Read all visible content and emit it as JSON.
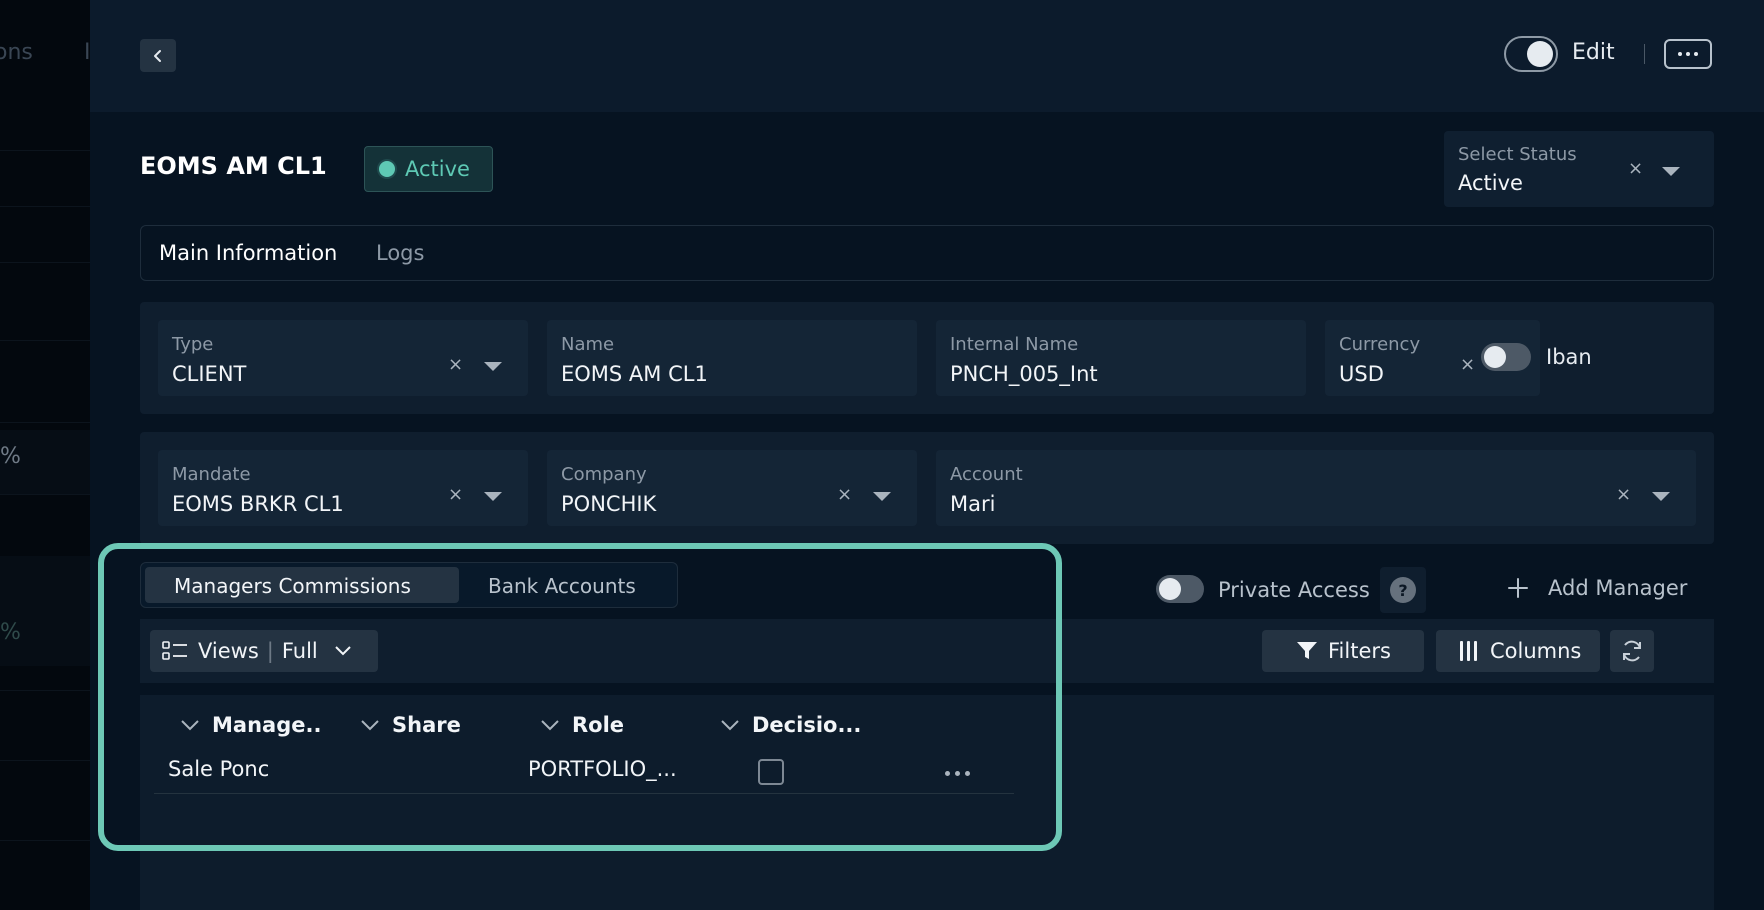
{
  "background": {
    "fragments": [
      "ons",
      "I",
      "%",
      "%"
    ]
  },
  "header": {
    "back_icon": "chevron-left-icon",
    "edit_label": "Edit",
    "edit_toggle_on": true
  },
  "record": {
    "title": "EOMS AM CL1",
    "status_badge": "Active",
    "status_color": "#5ec9b4"
  },
  "select_status": {
    "label": "Select Status",
    "value": "Active"
  },
  "tabs": [
    {
      "label": "Main Information",
      "active": true
    },
    {
      "label": "Logs",
      "active": false
    }
  ],
  "fields_row1": {
    "type": {
      "label": "Type",
      "value": "CLIENT"
    },
    "name": {
      "label": "Name",
      "value": "EOMS AM CL1"
    },
    "internal_name": {
      "label": "Internal Name",
      "value": "PNCH_005_Int"
    },
    "currency": {
      "label": "Currency",
      "value": "USD"
    },
    "iban": {
      "label": "Iban",
      "on": false
    }
  },
  "fields_row2": {
    "mandate": {
      "label": "Mandate",
      "value": "EOMS BRKR CL1"
    },
    "company": {
      "label": "Company",
      "value": "PONCHIK"
    },
    "account": {
      "label": "Account",
      "value": "Mari"
    }
  },
  "clear_glyph": "×",
  "subtabs": [
    {
      "label": "Managers Commissions",
      "active": true
    },
    {
      "label": "Bank Accounts",
      "active": false
    }
  ],
  "private_access": {
    "label": "Private Access",
    "on": false,
    "help": "?"
  },
  "add_manager": {
    "label": "Add Manager",
    "icon": "plus-icon"
  },
  "toolbar": {
    "views_label": "Views",
    "views_value": "Full",
    "filters_label": "Filters",
    "columns_label": "Columns",
    "refresh_icon": "refresh-icon"
  },
  "table": {
    "columns": [
      "Manage..",
      "Share",
      "Role",
      "Decisio..."
    ],
    "rows": [
      {
        "manager": "Sale Ponc",
        "share": "",
        "role": "PORTFOLIO_...",
        "decision": false
      }
    ]
  },
  "highlight_color": "#6dc8b6"
}
